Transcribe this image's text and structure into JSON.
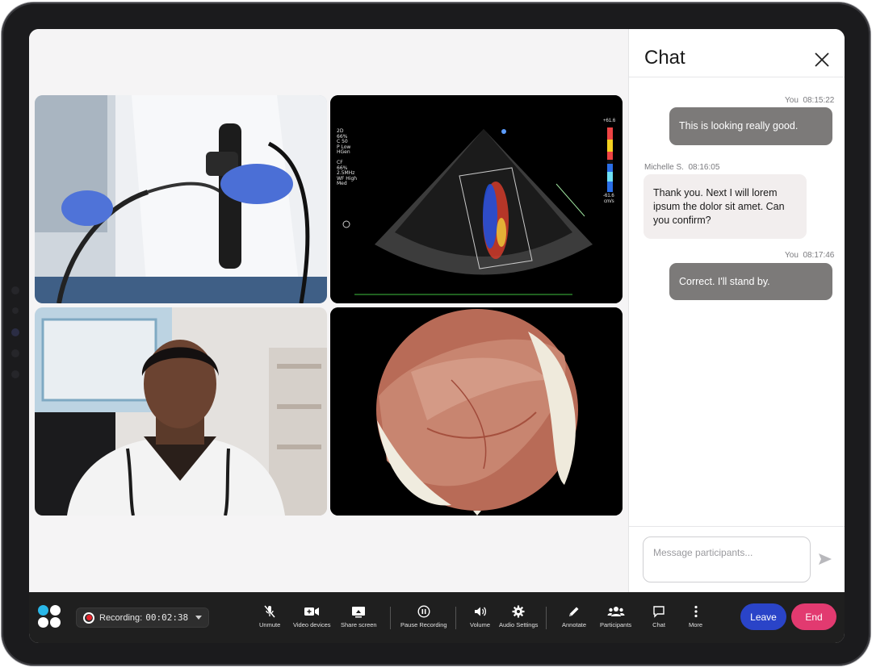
{
  "chat": {
    "title": "Chat",
    "messages": [
      {
        "sender": "You",
        "time": "08:15:22",
        "text": "This is looking really good."
      },
      {
        "sender": "Michelle S.",
        "time": "08:16:05",
        "text": "Thank you. Next I will lorem ipsum the dolor sit amet. Can you confirm?"
      },
      {
        "sender": "You",
        "time": "08:17:46",
        "text": "Correct. I'll stand by."
      }
    ],
    "input_placeholder": "Message participants..."
  },
  "toolbar": {
    "recording_label": "Recording:",
    "recording_time": "00:02:38",
    "unmute": "Unmute",
    "video_devices": "Video devices",
    "share_screen": "Share screen",
    "pause_recording": "Pause Recording",
    "volume": "Volume",
    "audio_settings": "Audio Settings",
    "annotate": "Annotate",
    "participants": "Participants",
    "chat": "Chat",
    "more": "More",
    "leave": "Leave",
    "end": "End"
  },
  "ultrasound_overlay": {
    "left_text": [
      "2D",
      "66%",
      "C 50",
      "P Low",
      "HGen",
      "",
      "CF",
      "66%",
      "2.5MHz",
      "WF High",
      "Med"
    ],
    "scale_top": "+61.6",
    "scale_bottom": "-61.6",
    "scale_unit": "cm/s"
  },
  "colors": {
    "leave": "#2a44c8",
    "end": "#e23a70",
    "record": "#e5242c",
    "logo": "#29b7e8"
  }
}
